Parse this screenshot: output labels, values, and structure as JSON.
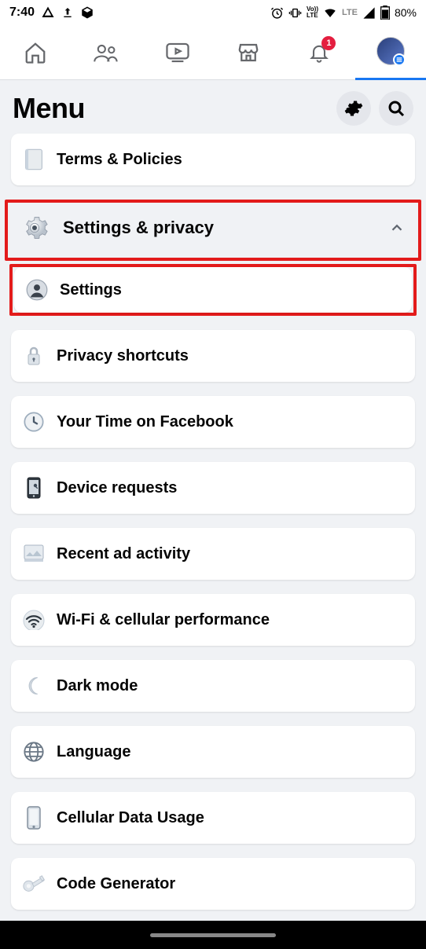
{
  "status": {
    "time": "7:40",
    "battery": "80%",
    "lte": "LTE",
    "volte": "Vo))\nLTE"
  },
  "nav": {
    "notification_badge": "1"
  },
  "header": {
    "title": "Menu"
  },
  "top_card": {
    "label": "Terms & Policies"
  },
  "group": {
    "label": "Settings & privacy"
  },
  "items": [
    {
      "label": "Settings",
      "highlight": true
    },
    {
      "label": "Privacy shortcuts"
    },
    {
      "label": "Your Time on Facebook"
    },
    {
      "label": "Device requests"
    },
    {
      "label": "Recent ad activity"
    },
    {
      "label": "Wi-Fi & cellular performance"
    },
    {
      "label": "Dark mode"
    },
    {
      "label": "Language"
    },
    {
      "label": "Cellular Data Usage"
    },
    {
      "label": "Code Generator"
    }
  ]
}
